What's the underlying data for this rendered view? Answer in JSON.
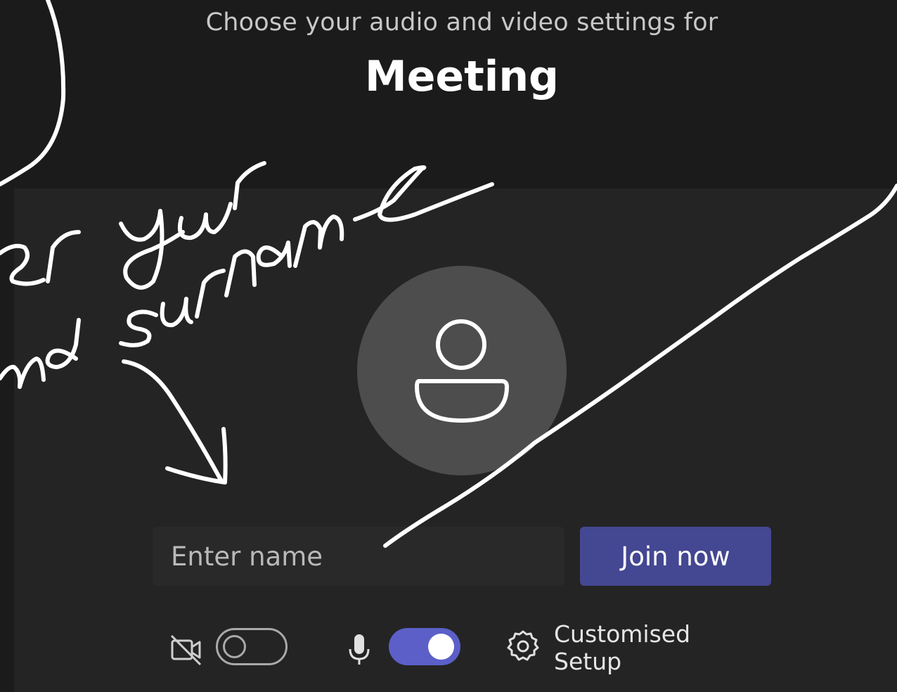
{
  "header": {
    "subtitle": "Choose your audio and video settings for",
    "title": "Meeting"
  },
  "avatar": {
    "icon": "person-icon"
  },
  "join_form": {
    "name_placeholder": "Enter name",
    "name_value": "",
    "join_label": "Join now"
  },
  "controls": {
    "camera": {
      "icon": "camera-off-icon",
      "on": false
    },
    "microphone": {
      "icon": "microphone-icon",
      "on": true
    },
    "setup": {
      "icon": "gear-icon",
      "label": "Customised Setup"
    }
  },
  "colors": {
    "background": "#1b1b1b",
    "panel": "#242424",
    "accent": "#5b5fc7",
    "join_button": "#444791"
  }
}
